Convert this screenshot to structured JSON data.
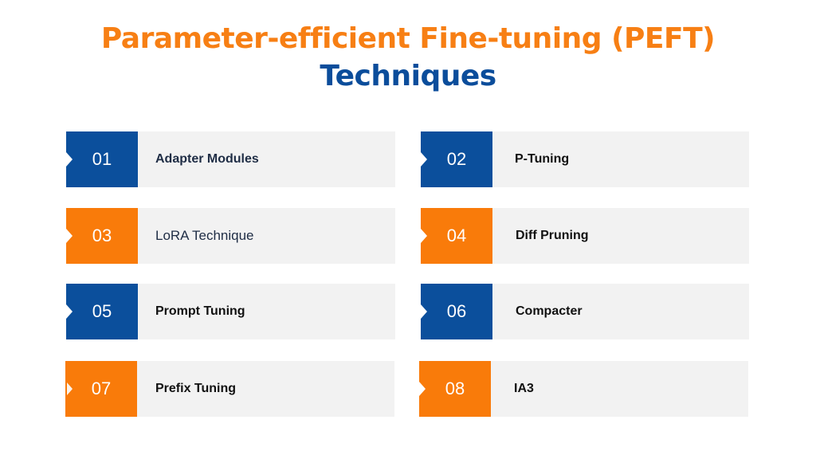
{
  "title": {
    "line1": "Parameter-efficient Fine-tuning (PEFT)",
    "line2": "Techniques"
  },
  "colors": {
    "orange": "#f97b0a",
    "blue": "#0b4f9c",
    "title_orange": "#f77f14",
    "title_blue": "#0b4d9b",
    "panel_gray": "#f2f2f2"
  },
  "techniques": [
    {
      "number": "01",
      "label": "Adapter Modules",
      "badge_color": "blue"
    },
    {
      "number": "02",
      "label": "P-Tuning",
      "badge_color": "blue"
    },
    {
      "number": "03",
      "label": "LoRA Technique",
      "badge_color": "orange"
    },
    {
      "number": "04",
      "label": "Diff Pruning",
      "badge_color": "orange"
    },
    {
      "number": "05",
      "label": "Prompt Tuning",
      "badge_color": "blue"
    },
    {
      "number": "06",
      "label": "Compacter",
      "badge_color": "blue"
    },
    {
      "number": "07",
      "label": "Prefix Tuning",
      "badge_color": "orange"
    },
    {
      "number": "08",
      "label": "IA3",
      "badge_color": "orange"
    }
  ]
}
